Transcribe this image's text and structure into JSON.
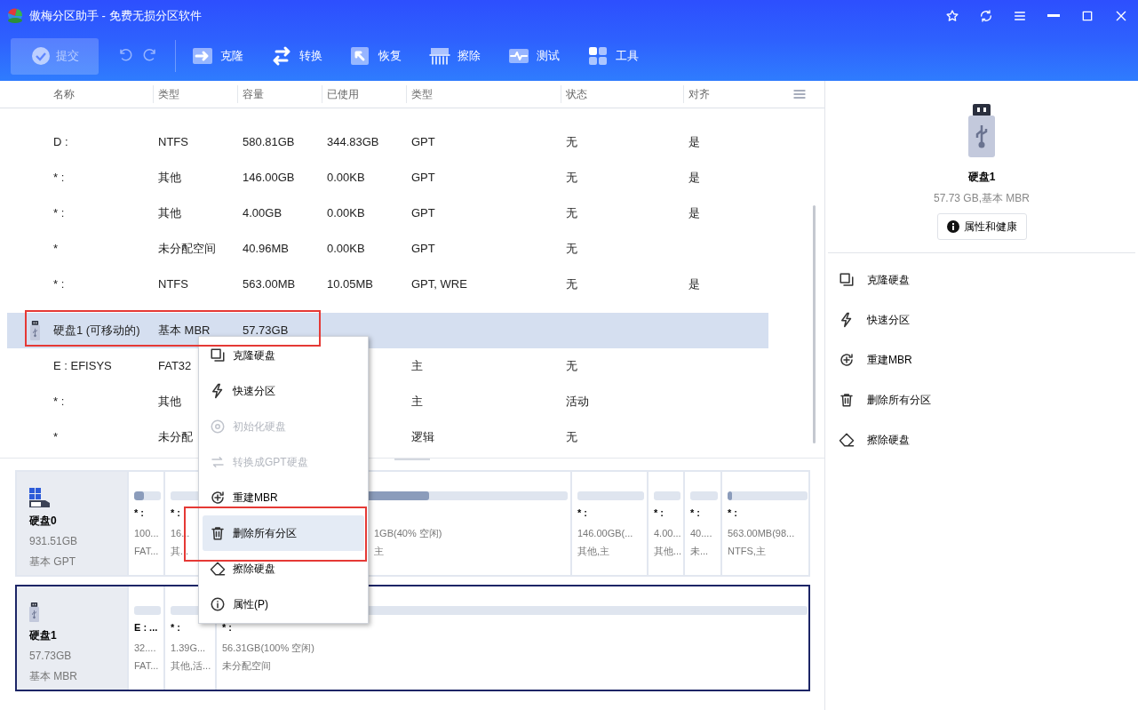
{
  "window": {
    "title": "傲梅分区助手 - 免费无损分区软件"
  },
  "toolbar": {
    "submit": {
      "label": "提交",
      "disabled": true
    },
    "tools": [
      "克隆",
      "转换",
      "恢复",
      "擦除",
      "测试",
      "工具"
    ]
  },
  "table": {
    "columns": [
      "名称",
      "类型",
      "容量",
      "已使用",
      "类型",
      "状态",
      "对齐"
    ],
    "rows": [
      {
        "kind": "partition",
        "selected": false,
        "name": "D :",
        "fs": "NTFS",
        "capacity": "580.81GB",
        "used": "344.83GB",
        "type": "GPT",
        "status": "无",
        "aligned": "是"
      },
      {
        "kind": "partition",
        "selected": false,
        "name": "* :",
        "fs": "其他",
        "capacity": "146.00GB",
        "used": "0.00KB",
        "type": "GPT",
        "status": "无",
        "aligned": "是"
      },
      {
        "kind": "partition",
        "selected": false,
        "name": "* :",
        "fs": "其他",
        "capacity": "4.00GB",
        "used": "0.00KB",
        "type": "GPT",
        "status": "无",
        "aligned": "是"
      },
      {
        "kind": "partition",
        "selected": false,
        "name": "*",
        "fs": "未分配空间",
        "capacity": "40.96MB",
        "used": "0.00KB",
        "type": "GPT",
        "status": "无"
      },
      {
        "kind": "partition",
        "selected": false,
        "name": "* :",
        "fs": "NTFS",
        "capacity": "563.00MB",
        "used": "10.05MB",
        "type": "GPT, WRE",
        "status": "无",
        "aligned": "是"
      },
      {
        "kind": "disk",
        "selected": true,
        "name": "硬盘1 (可移动的)",
        "fs": "基本 MBR",
        "capacity": "57.73GB"
      },
      {
        "kind": "partition",
        "selected": false,
        "name": "E : EFISYS",
        "fs": "FAT32",
        "type": "主",
        "status": "无"
      },
      {
        "kind": "partition",
        "selected": false,
        "name": "* :",
        "fs": "其他",
        "type": "主",
        "status": "活动"
      },
      {
        "kind": "partition",
        "selected": false,
        "name": "*",
        "fs": "未分配",
        "type": "逻辑",
        "status": "无"
      }
    ]
  },
  "disks": [
    {
      "name": "硬盘0",
      "size": "931.51GB",
      "type": "基本 GPT",
      "kind": "ssd",
      "selected": false,
      "partitions": [
        {
          "level": 0.35,
          "label": "* :",
          "size": "100...",
          "fs": "FAT..."
        },
        {
          "level": 0,
          "label": "* :",
          "size": "16...",
          "fs": "其..."
        },
        {
          "level": 0.6,
          "size": "1GB(40% 空闲)",
          "fs": "主"
        },
        {
          "level": 0,
          "label": "* :",
          "size": "146.00GB(...",
          "fs": "其他,主"
        },
        {
          "level": 0,
          "label": "* :",
          "size": "4.00...",
          "fs": "其他..."
        },
        {
          "level": 0,
          "label": "* :",
          "size": "40....",
          "fs": "未..."
        },
        {
          "level": 0.06,
          "label": "* :",
          "size": "563.00MB(98...",
          "fs": "NTFS,主"
        }
      ]
    },
    {
      "name": "硬盘1",
      "size": "57.73GB",
      "type": "基本 MBR",
      "kind": "usb",
      "selected": true,
      "partitions": [
        {
          "level": 0,
          "label": "E : ...",
          "size": "32....",
          "fs": "FAT..."
        },
        {
          "level": 0,
          "label": "* :",
          "size": "1.39G...",
          "fs": "其他,活..."
        },
        {
          "level": 0,
          "label": "* :",
          "size": "56.31GB(100% 空闲)",
          "fs": "未分配空间"
        }
      ]
    }
  ],
  "context_menu": [
    {
      "label": "克隆硬盘",
      "disabled": false,
      "selected": false
    },
    {
      "label": "快速分区",
      "disabled": false,
      "selected": false
    },
    {
      "label": "初始化硬盘",
      "disabled": true,
      "selected": false
    },
    {
      "label": "转换成GPT硬盘",
      "disabled": true,
      "selected": false
    },
    {
      "label": "重建MBR",
      "disabled": false,
      "selected": false
    },
    {
      "label": "删除所有分区",
      "disabled": false,
      "selected": true
    },
    {
      "label": "擦除硬盘",
      "disabled": false,
      "selected": false
    },
    {
      "label": "属性(P)",
      "disabled": false,
      "selected": false
    }
  ],
  "details": {
    "name": "硬盘1",
    "summary": "57.73 GB,基本 MBR",
    "button": "属性和健康",
    "actions": [
      "克隆硬盘",
      "快速分区",
      "重建MBR",
      "删除所有分区",
      "擦除硬盘"
    ]
  }
}
